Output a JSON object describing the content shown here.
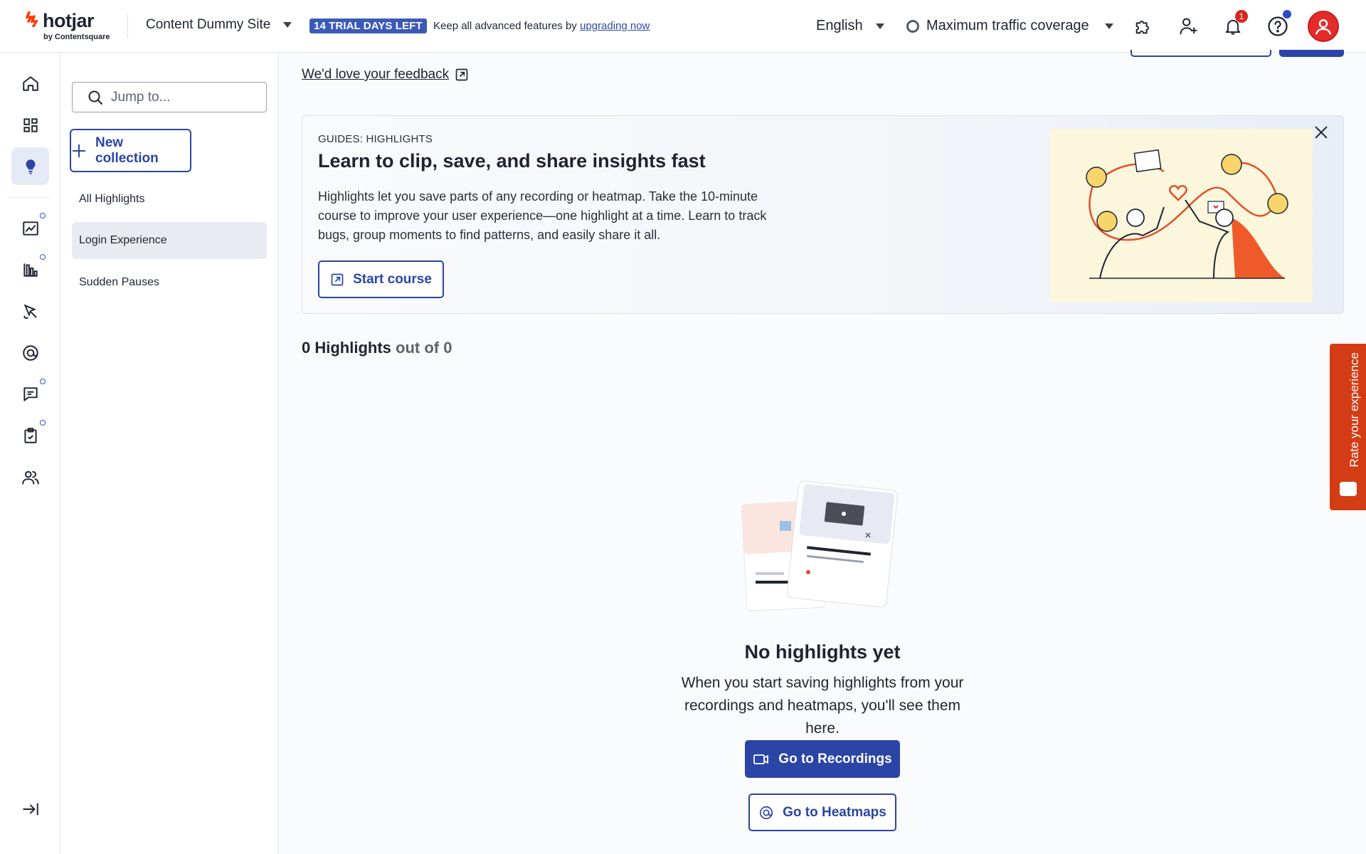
{
  "brand": {
    "name": "hotjar",
    "sub": "by Contentsquare"
  },
  "header": {
    "site": "Content Dummy Site",
    "trial_badge": "14 TRIAL DAYS LEFT",
    "upgrade_prefix": "Keep all advanced features by ",
    "upgrade_link": "upgrading now",
    "language": "English",
    "traffic": "Maximum traffic coverage",
    "notifications_count": "1"
  },
  "sidebar": {
    "search_placeholder": "Jump to...",
    "new_collection": "New collection",
    "collections": [
      "All Highlights",
      "Login Experience",
      "Sudden Pauses"
    ]
  },
  "main": {
    "feedback_link": "We'd love your feedback",
    "guide": {
      "tag": "GUIDES: HIGHLIGHTS",
      "title": "Learn to clip, save, and share insights fast",
      "body": "Highlights let you save parts of any recording or heatmap. Take the 10-minute course to improve your user experience—one highlight at a time. Learn to track bugs, group moments to find patterns, and easily share it all.",
      "button": "Start course"
    },
    "count_strong": "0 Highlights",
    "count_muted": "out of 0",
    "empty": {
      "title": "No highlights yet",
      "body": "When you start saving highlights from your recordings and heatmaps, you'll see them here.",
      "btn_recordings": "Go to Recordings",
      "btn_heatmaps": "Go to Heatmaps"
    }
  },
  "rate_tab": "Rate your experience",
  "colors": {
    "primary": "#2a45a5",
    "accent": "#d33c14",
    "trial_badge": "#3b5ab8"
  }
}
